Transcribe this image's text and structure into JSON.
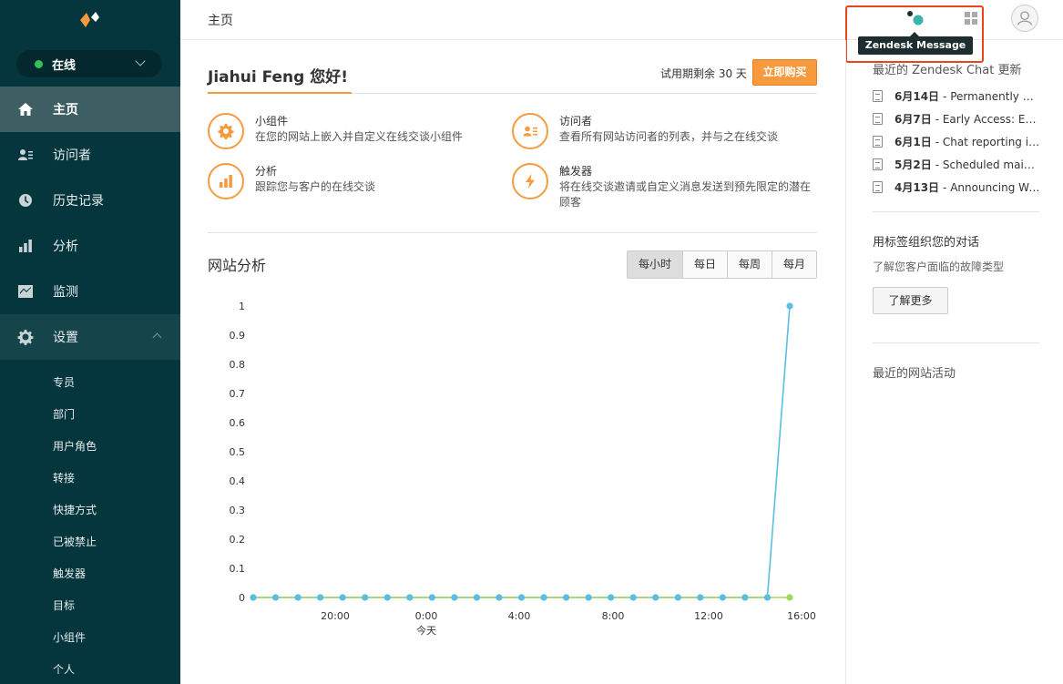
{
  "sidebar": {
    "status_label": "在线",
    "nav": [
      {
        "label": "主页",
        "icon": "home-icon"
      },
      {
        "label": "访问者",
        "icon": "visitors-icon"
      },
      {
        "label": "历史记录",
        "icon": "history-icon"
      },
      {
        "label": "分析",
        "icon": "analytics-icon"
      },
      {
        "label": "监测",
        "icon": "monitor-icon"
      },
      {
        "label": "设置",
        "icon": "gear-icon"
      }
    ],
    "subnav": [
      "专员",
      "部门",
      "用户角色",
      "转接",
      "快捷方式",
      "已被禁止",
      "触发器",
      "目标",
      "小组件",
      "个人"
    ]
  },
  "topbar": {
    "title": "主页",
    "tooltip": "Zendesk Message"
  },
  "main": {
    "greeting": "Jiahui Feng 您好!",
    "trial_text": "试用期剩余 30 天",
    "buy_label": "立即购买",
    "features": [
      {
        "title": "小组件",
        "desc": "在您的网站上嵌入并自定义在线交谈小组件",
        "icon": "gear-icon"
      },
      {
        "title": "访问者",
        "desc": "查看所有网站访问者的列表，并与之在线交谈",
        "icon": "visitor-card-icon"
      },
      {
        "title": "分析",
        "desc": "跟踪您与客户的在线交谈",
        "icon": "bar-chart-icon"
      },
      {
        "title": "触发器",
        "desc": "将在线交谈邀请或自定义消息发送到预先限定的潜在顾客",
        "icon": "lightning-icon"
      }
    ],
    "analytics_title": "网站分析",
    "periods": [
      "每小时",
      "每日",
      "每周",
      "每月"
    ],
    "selected_period": "每小时"
  },
  "chart_data": {
    "type": "line",
    "title": "",
    "xlabel": "",
    "ylabel": "",
    "ylim": [
      0,
      1
    ],
    "yticks": [
      "0",
      "0.1",
      "0.2",
      "0.3",
      "0.4",
      "0.5",
      "0.6",
      "0.7",
      "0.8",
      "0.9",
      "1"
    ],
    "xtick_labels": [
      "20:00",
      "0:00",
      "4:00",
      "8:00",
      "12:00",
      "16:00"
    ],
    "xtick_sublabel": "今天",
    "series": [
      {
        "color": "#a5d65a",
        "values": [
          0,
          0,
          0,
          0,
          0,
          0,
          0,
          0,
          0,
          0,
          0,
          0,
          0,
          0,
          0,
          0,
          0,
          0,
          0,
          0,
          0,
          0,
          0,
          0,
          0
        ]
      },
      {
        "color": "#5bbde4",
        "values": [
          0,
          0,
          0,
          0,
          0,
          0,
          0,
          0,
          0,
          0,
          0,
          0,
          0,
          0,
          0,
          0,
          0,
          0,
          0,
          0,
          0,
          0,
          0,
          0,
          1
        ]
      }
    ]
  },
  "right": {
    "updates_heading": "最近的 Zendesk Chat 更新",
    "updates": [
      {
        "date": "6月14日",
        "text": "- Permanently Del..."
      },
      {
        "date": "6月7日",
        "text": "- Early Access: Enh..."
      },
      {
        "date": "6月1日",
        "text": "- Chat reporting in I..."
      },
      {
        "date": "5月2日",
        "text": "- Scheduled mainte..."
      },
      {
        "date": "4月13日",
        "text": "- Announcing Web..."
      }
    ],
    "tags_title": "用标签组织您的对话",
    "tags_sub": "了解您客户面临的故障类型",
    "learn_more": "了解更多",
    "activity_heading": "最近的网站活动"
  }
}
